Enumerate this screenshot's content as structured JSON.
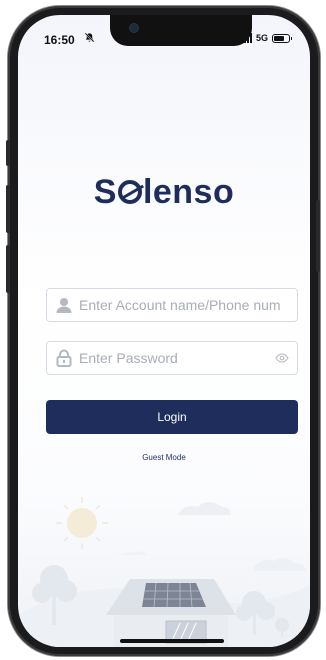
{
  "status_bar": {
    "time": "16:50",
    "network": "5G"
  },
  "brand": {
    "logo_prefix": "S",
    "logo_suffix": "lenso",
    "primary_color": "#1e2d5c"
  },
  "login_form": {
    "account_placeholder": "Enter Account name/Phone num",
    "password_placeholder": "Enter Password",
    "login_label": "Login",
    "guest_label": "Guest Mode"
  },
  "icons": {
    "account": "user-icon",
    "password": "lock-icon",
    "visibility": "eye-icon"
  }
}
